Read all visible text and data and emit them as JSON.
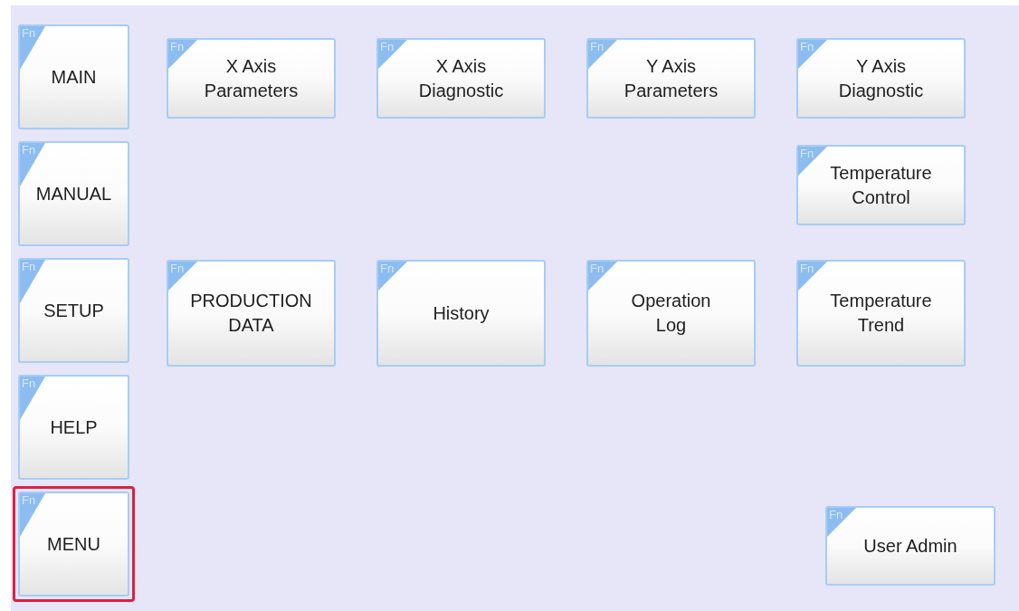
{
  "sidebar": {
    "items": [
      {
        "label": "MAIN",
        "tag": "Fn",
        "selected": false
      },
      {
        "label": "MANUAL",
        "tag": "Fn",
        "selected": false
      },
      {
        "label": "SETUP",
        "tag": "Fn",
        "selected": false
      },
      {
        "label": "HELP",
        "tag": "Fn",
        "selected": false
      },
      {
        "label": "MENU",
        "tag": "Fn",
        "selected": true
      }
    ]
  },
  "grid": {
    "rows": [
      {
        "kind": "short",
        "slots": [
          {
            "label": "X Axis\nParameters",
            "tag": "Fn"
          },
          {
            "label": "X Axis\nDiagnostic",
            "tag": "Fn"
          },
          {
            "label": "Y Axis\nParameters",
            "tag": "Fn"
          },
          {
            "label": "Y Axis\nDiagnostic",
            "tag": "Fn"
          }
        ]
      },
      {
        "kind": "short_right",
        "slots": [
          {
            "label": "Temperature\nControl",
            "tag": "Fn"
          }
        ]
      },
      {
        "kind": "tall",
        "slots": [
          {
            "label": "PRODUCTION\nDATA",
            "tag": "Fn"
          },
          {
            "label": "History",
            "tag": "Fn"
          },
          {
            "label": "Operation\nLog",
            "tag": "Fn"
          },
          {
            "label": "Temperature\nTrend",
            "tag": "Fn"
          }
        ]
      }
    ]
  },
  "footer_button": {
    "label": "User Admin",
    "tag": "Fn"
  }
}
